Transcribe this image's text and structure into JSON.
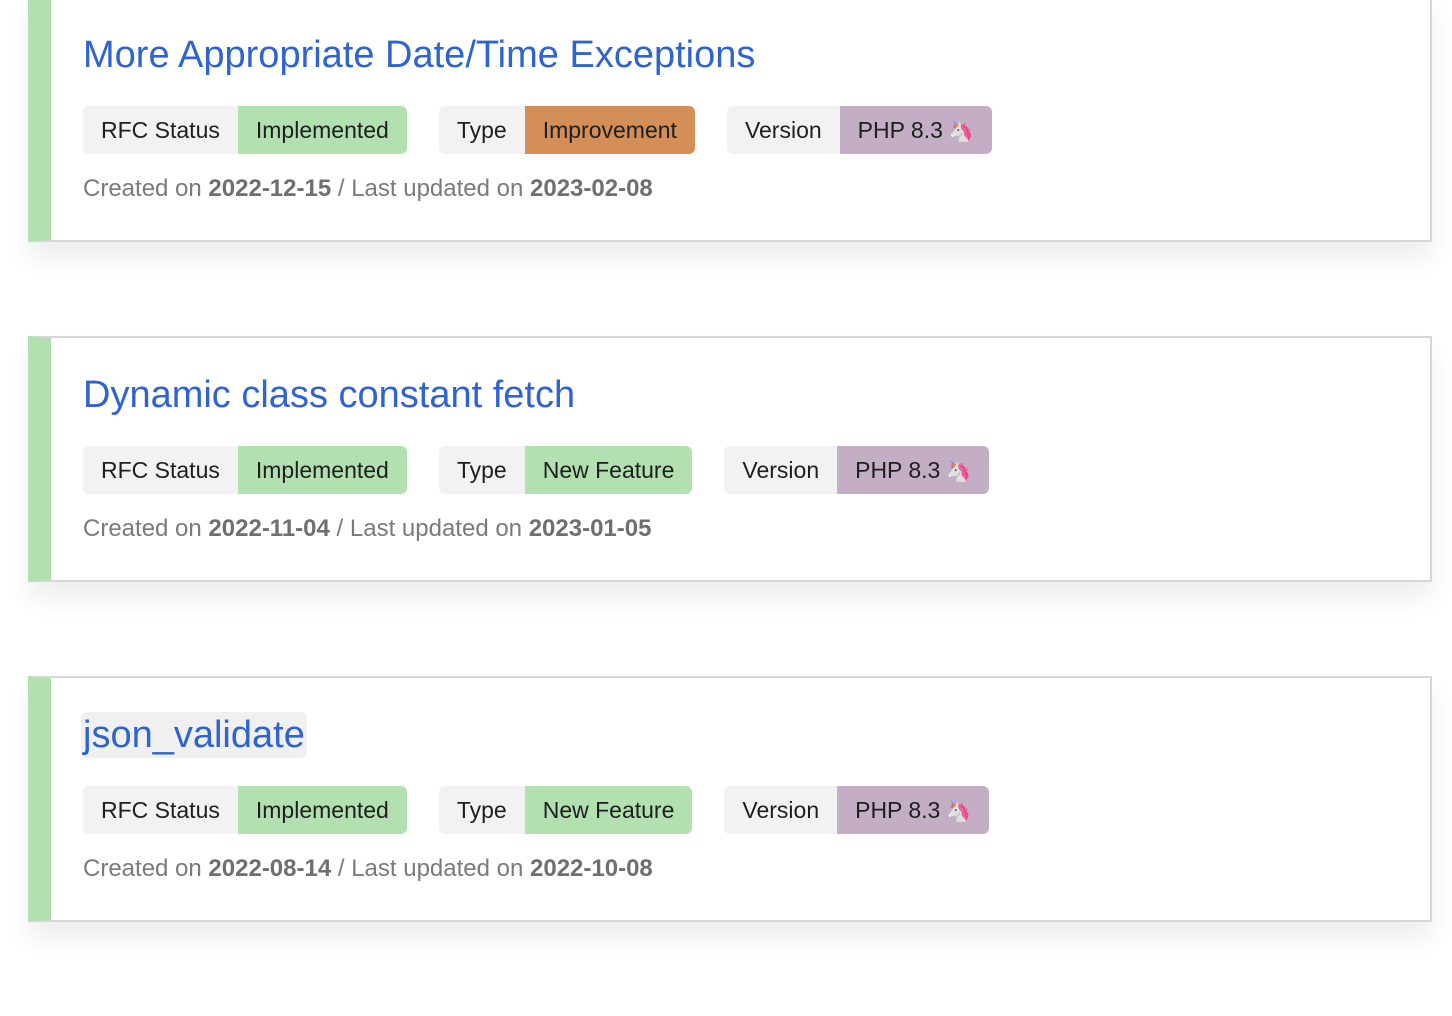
{
  "rfcs": [
    {
      "title": "More Appropriate Date/Time Exceptions",
      "status_label": "RFC Status",
      "status_value": "Implemented",
      "type_label": "Type",
      "type_value": "Improvement",
      "version_label": "Version",
      "version_value": "PHP 8.3",
      "version_icon": "unicorn-icon",
      "created_prefix": "Created on",
      "created_date": "2022-12-15",
      "updated_prefix": "/ Last updated on",
      "updated_date": "2023-02-08",
      "accent": "#b3e0b0"
    },
    {
      "title": "Dynamic class constant fetch",
      "status_label": "RFC Status",
      "status_value": "Implemented",
      "type_label": "Type",
      "type_value": "New Feature",
      "version_label": "Version",
      "version_value": "PHP 8.3",
      "version_icon": "unicorn-icon",
      "created_prefix": "Created on",
      "created_date": "2022-11-04",
      "updated_prefix": "/ Last updated on",
      "updated_date": "2023-01-05",
      "accent": "#b3e0b0"
    },
    {
      "title": "json_validate",
      "status_label": "RFC Status",
      "status_value": "Implemented",
      "type_label": "Type",
      "type_value": "New Feature",
      "version_label": "Version",
      "version_value": "PHP 8.3",
      "version_icon": "unicorn-icon",
      "created_prefix": "Created on",
      "created_date": "2022-08-14",
      "updated_prefix": "/ Last updated on",
      "updated_date": "2022-10-08",
      "accent": "#b3e0b0"
    }
  ],
  "colors": {
    "title_link": "#2f63cf",
    "status_implemented": "#b3e0b0",
    "type_improvement": "#d48e58",
    "type_new_feature": "#b3e0b0",
    "version_php83": "#c4aec6",
    "badge_key_bg": "#f2f2f2",
    "meta_text": "#7a7a7a"
  }
}
